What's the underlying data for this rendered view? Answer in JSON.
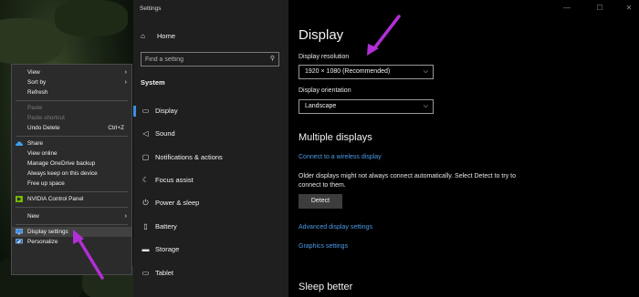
{
  "colors": {
    "accent": "#3c8ce6",
    "link": "#4d9be8",
    "annotation": "#b12fd6",
    "nav_bg": "#1f1f1f",
    "content_bg": "#000000"
  },
  "context_menu": {
    "items": [
      {
        "label": "View",
        "submenu": true
      },
      {
        "label": "Sort by",
        "submenu": true
      },
      {
        "label": "Refresh"
      },
      {
        "label": "Paste",
        "disabled": true
      },
      {
        "label": "Paste shortcut",
        "disabled": true
      },
      {
        "label": "Undo Delete",
        "shortcut": "Ctrl+Z"
      },
      {
        "label": "Share",
        "icon": "onedrive-icon"
      },
      {
        "label": "View online"
      },
      {
        "label": "Manage OneDrive backup"
      },
      {
        "label": "Always keep on this device"
      },
      {
        "label": "Free up space"
      },
      {
        "label": "NVIDIA Control Panel",
        "icon": "nvidia-icon"
      },
      {
        "label": "New",
        "submenu": true
      },
      {
        "label": "Display settings",
        "icon": "display-icon"
      },
      {
        "label": "Personalize",
        "icon": "personalize-icon"
      }
    ]
  },
  "window": {
    "title": "Settings",
    "controls": {
      "minimize": "—",
      "maximize": "☐",
      "close": "✕"
    }
  },
  "nav": {
    "home": "Home",
    "search_placeholder": "Find a setting",
    "section": "System",
    "items": [
      {
        "label": "Display",
        "icon": "display-icon"
      },
      {
        "label": "Sound",
        "icon": "sound-icon"
      },
      {
        "label": "Notifications & actions",
        "icon": "notifications-icon"
      },
      {
        "label": "Focus assist",
        "icon": "focus-assist-icon"
      },
      {
        "label": "Power & sleep",
        "icon": "power-icon"
      },
      {
        "label": "Battery",
        "icon": "battery-icon"
      },
      {
        "label": "Storage",
        "icon": "storage-icon"
      },
      {
        "label": "Tablet",
        "icon": "tablet-icon"
      }
    ]
  },
  "content": {
    "title": "Display",
    "resolution_label": "Display resolution",
    "resolution_value": "1920 × 1080 (Recommended)",
    "orientation_label": "Display orientation",
    "orientation_value": "Landscape",
    "multiple_displays": "Multiple displays",
    "connect_link": "Connect to a wireless display",
    "detect_text": "Older displays might not always connect automatically. Select Detect to try to connect to them.",
    "detect_button": "Detect",
    "advanced_link": "Advanced display settings",
    "graphics_link": "Graphics settings",
    "sleep_better": "Sleep better"
  }
}
